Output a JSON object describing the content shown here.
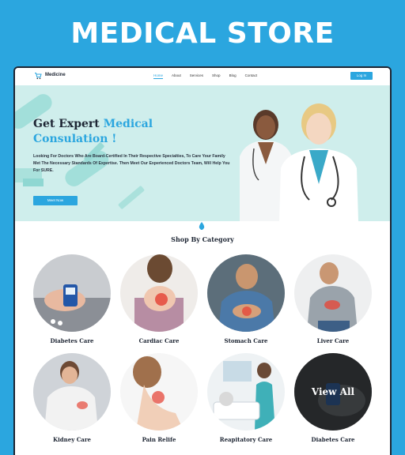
{
  "banner": {
    "title": "MEDICAL STORE"
  },
  "nav": {
    "logo": "Medicine",
    "links": [
      "Home",
      "About",
      "Services",
      "Shop",
      "Blog",
      "Contact"
    ],
    "login": "Log In"
  },
  "hero": {
    "title_part1": "Get Expert ",
    "title_highlight": "Medical Consulation !",
    "description": "Looking For Doctors Who Are Board-Certified In Their Respective Specialties, To Care Your Family Met The Necessary Standards Of Expertise. Then Meet Our Experienced Doctors Team, Will Help You For SURE.",
    "button": "Meet Now"
  },
  "categories": {
    "title": "Shop By Category",
    "items": [
      {
        "label": "Diabetes Care"
      },
      {
        "label": "Cardiac Care"
      },
      {
        "label": "Stomach Care"
      },
      {
        "label": "Liver Care"
      },
      {
        "label": "Kidney Care"
      },
      {
        "label": "Pain Relife"
      },
      {
        "label": "Reapitatory Care"
      },
      {
        "label": "Diabetes Care",
        "overlay": "View All"
      }
    ]
  },
  "colors": {
    "accent": "#2ba6df",
    "hero_bg": "#cfeeec",
    "dark": "#1d2533"
  }
}
